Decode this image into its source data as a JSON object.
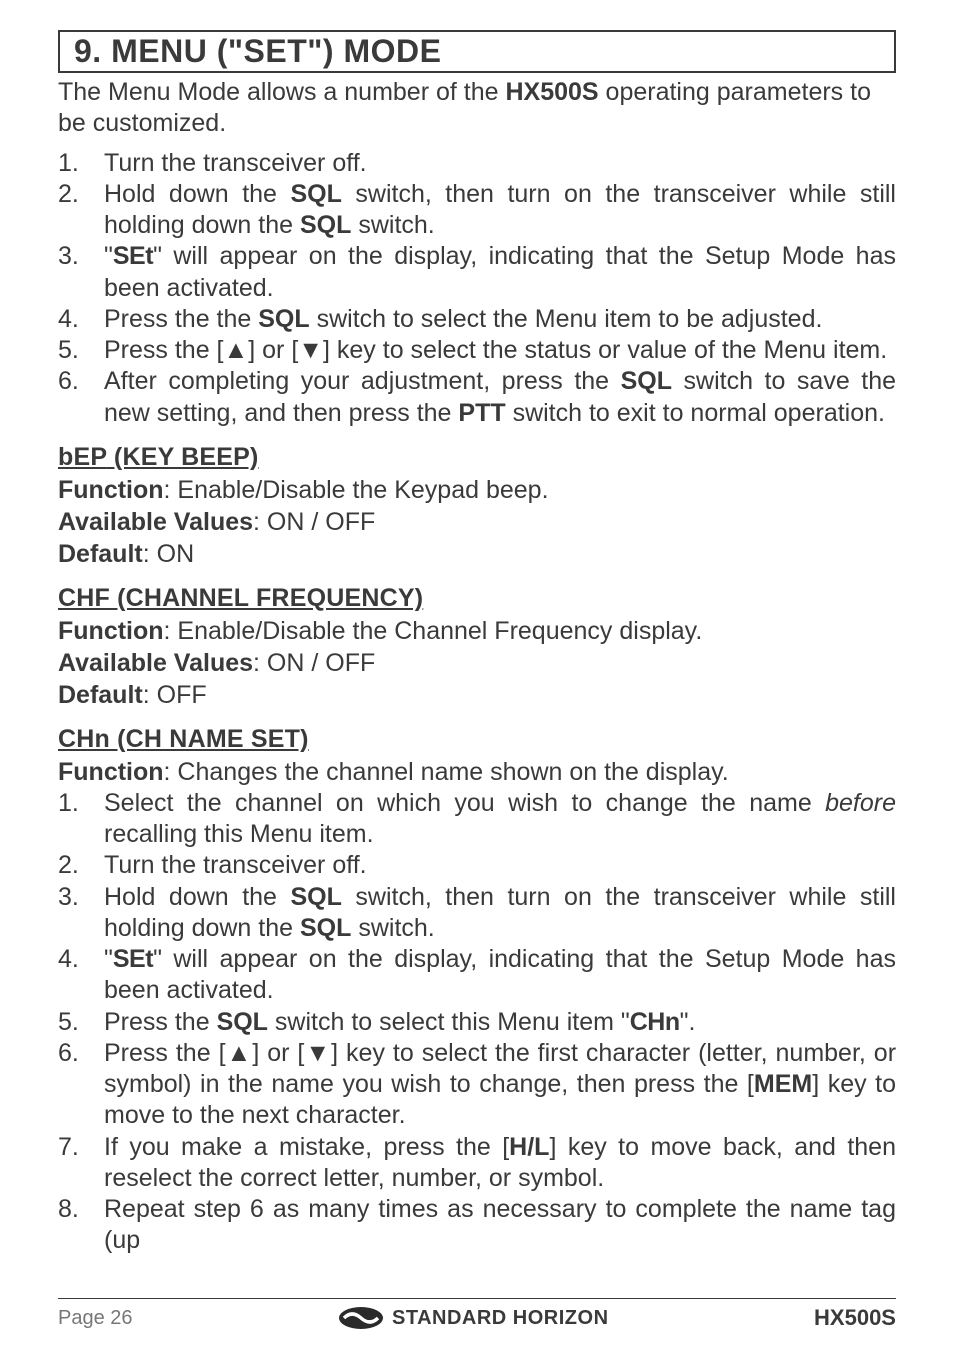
{
  "section": {
    "title": "9. MENU (\"SET\") MODE"
  },
  "intro": {
    "prefix": "The Menu Mode allows a number of the ",
    "model": "HX500S",
    "suffix": " operating parameters to be customized."
  },
  "steps_main": [
    {
      "num": "1.",
      "parts": [
        {
          "t": "Turn the transceiver off."
        }
      ]
    },
    {
      "num": "2.",
      "parts": [
        {
          "t": "Hold down the "
        },
        {
          "b": "SQL"
        },
        {
          "t": " switch, then turn on the transceiver while still holding down the "
        },
        {
          "b": "SQL"
        },
        {
          "t": " switch."
        }
      ]
    },
    {
      "num": "3.",
      "parts": [
        {
          "t": "\""
        },
        {
          "m": "SEt"
        },
        {
          "t": "\" will appear on the display, indicating that the Setup Mode has been activated."
        }
      ]
    },
    {
      "num": "4.",
      "parts": [
        {
          "t": "Press the the "
        },
        {
          "b": "SQL"
        },
        {
          "t": " switch to select the Menu item to be adjusted."
        }
      ]
    },
    {
      "num": "5.",
      "parts": [
        {
          "t": "Press the ["
        },
        {
          "sym": "▲"
        },
        {
          "t": "] or ["
        },
        {
          "sym": "▼"
        },
        {
          "t": "] key to select the status or value of the Menu item."
        }
      ]
    },
    {
      "num": "6.",
      "parts": [
        {
          "t": "After completing your adjustment, press the "
        },
        {
          "b": "SQL"
        },
        {
          "t": " switch to save the new setting, and then press the "
        },
        {
          "b": "PTT"
        },
        {
          "t": " switch to exit to normal operation."
        }
      ]
    }
  ],
  "items": [
    {
      "code": "bEP",
      "name": "KEY BEEP",
      "function": "Enable/Disable the Keypad beep.",
      "avail": "ON / OFF",
      "default": "ON"
    },
    {
      "code": "CHF",
      "name": "CHANNEL FREQUENCY",
      "function": "Enable/Disable the Channel Frequency display.",
      "avail": "ON / OFF",
      "default": "OFF"
    },
    {
      "code": "CHn",
      "name": "CH NAME SET",
      "function": "Changes the channel name shown on the display.",
      "steps": [
        {
          "num": "1.",
          "parts": [
            {
              "t": "Select the channel on which you wish to change the name "
            },
            {
              "i": "before"
            },
            {
              "t": " recalling this Menu item."
            }
          ]
        },
        {
          "num": "2.",
          "parts": [
            {
              "t": "Turn the transceiver off."
            }
          ]
        },
        {
          "num": "3.",
          "parts": [
            {
              "t": "Hold down the "
            },
            {
              "b": "SQL"
            },
            {
              "t": " switch, then turn on the transceiver while still holding down the "
            },
            {
              "b": "SQL"
            },
            {
              "t": " switch."
            }
          ]
        },
        {
          "num": "4.",
          "parts": [
            {
              "t": "\""
            },
            {
              "m": "SEt"
            },
            {
              "t": "\" will appear on the display, indicating that the Setup Mode has been activated."
            }
          ]
        },
        {
          "num": "5.",
          "parts": [
            {
              "t": "Press the "
            },
            {
              "b": "SQL"
            },
            {
              "t": " switch to select this Menu item \""
            },
            {
              "m": "CHn"
            },
            {
              "t": "\"."
            }
          ]
        },
        {
          "num": "6.",
          "parts": [
            {
              "t": "Press the ["
            },
            {
              "sym": "▲"
            },
            {
              "t": "] or ["
            },
            {
              "sym": "▼"
            },
            {
              "t": "] key to select the first character (letter, number, or symbol) in the name you wish to change, then press the ["
            },
            {
              "b": "MEM"
            },
            {
              "t": "] key to move to the next character."
            }
          ]
        },
        {
          "num": "7.",
          "parts": [
            {
              "t": "If you make a mistake, press the ["
            },
            {
              "b": "H/L"
            },
            {
              "t": "] key to move back, and then reselect the correct letter, number, or symbol."
            }
          ]
        },
        {
          "num": "8.",
          "parts": [
            {
              "t": "Repeat step 6 as many times as necessary to complete the name tag (up"
            }
          ]
        }
      ]
    }
  ],
  "labels": {
    "function": "Function",
    "available": "Available Values",
    "default": "Default"
  },
  "footer": {
    "page": "Page 26",
    "brand": "STANDARD HORIZON",
    "model": "HX500S"
  }
}
